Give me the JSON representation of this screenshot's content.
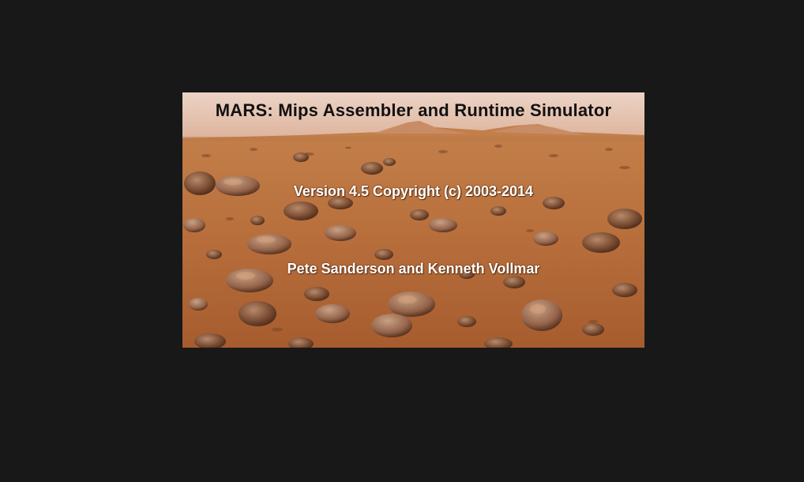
{
  "splash": {
    "title": "MARS: Mips Assembler and Runtime Simulator",
    "version": "Version 4.5 Copyright (c) 2003-2014",
    "authors": "Pete Sanderson and Kenneth Vollmar",
    "background_image": "mars-terrain-photo"
  }
}
